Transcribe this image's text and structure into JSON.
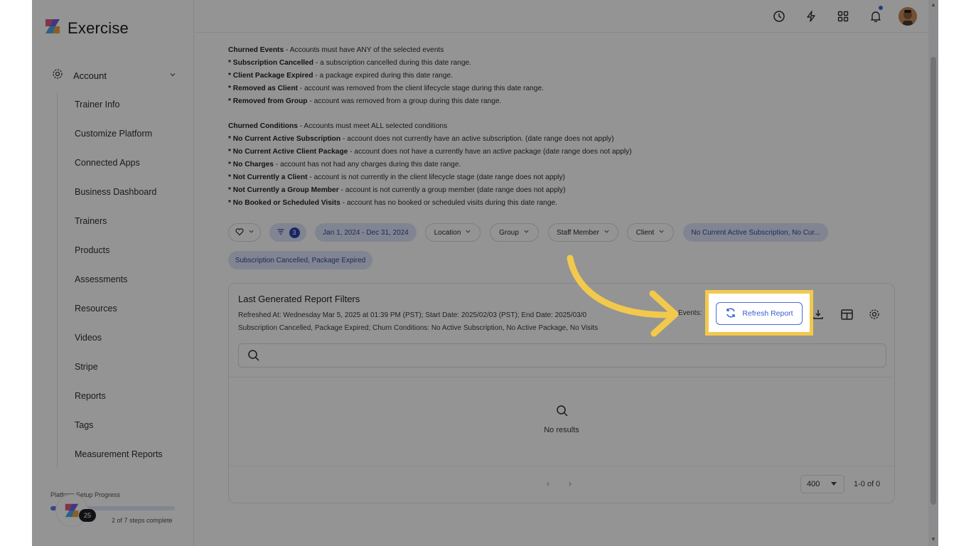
{
  "app": {
    "brand": "Exercise"
  },
  "sidebar": {
    "account_label": "Account",
    "items": [
      {
        "label": "Trainer Info"
      },
      {
        "label": "Customize Platform"
      },
      {
        "label": "Connected Apps"
      },
      {
        "label": "Business Dashboard"
      },
      {
        "label": "Trainers"
      },
      {
        "label": "Products"
      },
      {
        "label": "Assessments"
      },
      {
        "label": "Resources"
      },
      {
        "label": "Videos"
      },
      {
        "label": "Stripe"
      },
      {
        "label": "Reports"
      },
      {
        "label": "Tags"
      },
      {
        "label": "Measurement Reports"
      }
    ],
    "setup": {
      "title": "Platform Setup Progress",
      "badge": "25",
      "steps": "2 of 7 steps complete",
      "progress_fraction": 0.29
    }
  },
  "topbar": {
    "icons": [
      "history-icon",
      "bolt-icon",
      "apps-grid-icon",
      "bell-icon"
    ],
    "has_notification": true
  },
  "description": {
    "churned_events": {
      "title": "Churned Events",
      "text": " - Accounts must have ANY of the selected events",
      "items": [
        {
          "name": "Subscription Cancelled",
          "text": " - a subscription cancelled during this date range."
        },
        {
          "name": "Client Package Expired",
          "text": " - a package expired during this date range."
        },
        {
          "name": "Removed as Client",
          "text": " - account was removed from the client lifecycle stage during this date range."
        },
        {
          "name": "Removed from Group",
          "text": " - account was removed from a group during this date range."
        }
      ]
    },
    "churned_conditions": {
      "title": "Churned Conditions",
      "text": " - Accounts must meet ALL selected conditions",
      "items": [
        {
          "name": "No Current Active Subscription",
          "text": " - account does not currently have an active subscription. (date range does not apply)"
        },
        {
          "name": "No Current Active Client Package",
          "text": " - account does not have a currently have an active package (date range does not apply)"
        },
        {
          "name": "No Charges",
          "text": " - account has not had any charges during this date range."
        },
        {
          "name": "Not Currently a Client",
          "text": " - account is not currently in the client lifecycle stage (date range does not apply)"
        },
        {
          "name": "Not Currently a Group Member",
          "text": " - account is not currently a group member (date range does not apply)"
        },
        {
          "name": "No Booked or Scheduled Visits",
          "text": " - account has no booked or scheduled visits during this date range."
        }
      ]
    },
    "bullet": "* "
  },
  "filters": {
    "filter_count": "3",
    "date_range": "Jan 1, 2024 - Dec 31, 2024",
    "location": "Location",
    "group": "Group",
    "staff": "Staff Member",
    "client": "Client",
    "conditions": "No Current Active Subscription, No Cur...",
    "events": "Subscription Cancelled, Package Expired"
  },
  "report": {
    "title": "Last Generated Report Filters",
    "subtitle_line1": "Refreshed At: Wednesday Mar 5, 2025 at 01:39 PM (PST); Start Date: 2025/02/03 (PST); End Date: 2025/03/0",
    "events_label": "Events:",
    "subtitle_line2": "Subscription Cancelled, Package Expired; Churn Conditions: No Active Subscription, No Active Package, No Visits",
    "refresh_label": "Refresh Report",
    "search_placeholder": "",
    "empty_text": "No results",
    "page_size": "400",
    "range_text": "1-0 of 0"
  },
  "colors": {
    "highlight": "#f2c94c",
    "accent": "#3a5bd0"
  }
}
